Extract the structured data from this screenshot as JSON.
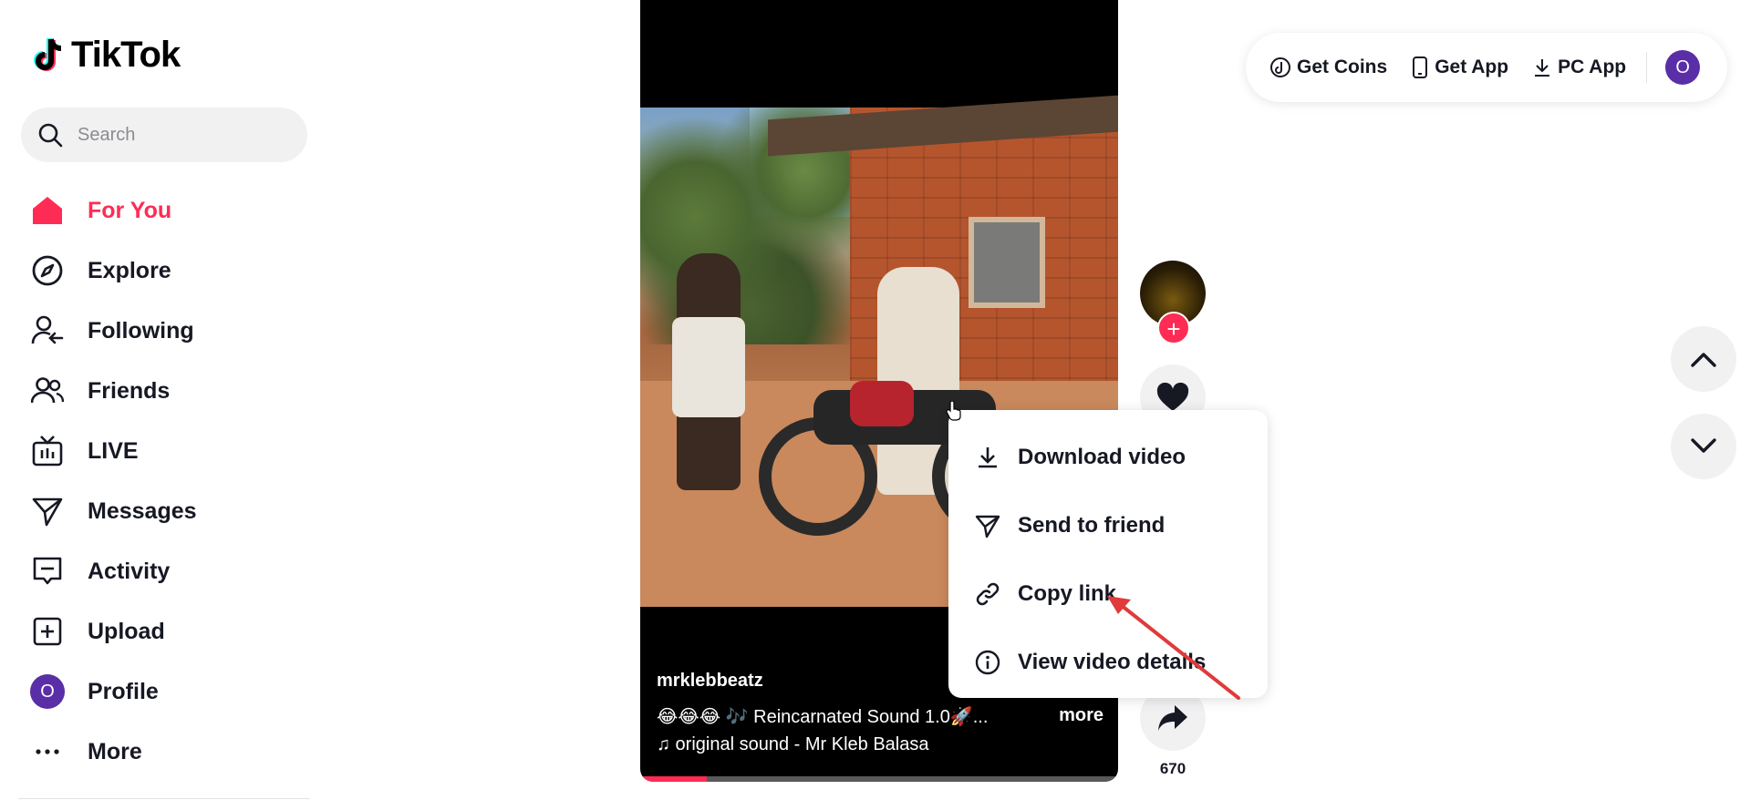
{
  "brand": {
    "name": "TikTok"
  },
  "search": {
    "placeholder": "Search"
  },
  "nav": {
    "items": [
      {
        "label": "For You",
        "icon": "home-icon",
        "active": true
      },
      {
        "label": "Explore",
        "icon": "compass-icon"
      },
      {
        "label": "Following",
        "icon": "following-icon"
      },
      {
        "label": "Friends",
        "icon": "friends-icon"
      },
      {
        "label": "LIVE",
        "icon": "live-icon"
      },
      {
        "label": "Messages",
        "icon": "messages-icon"
      },
      {
        "label": "Activity",
        "icon": "activity-icon"
      },
      {
        "label": "Upload",
        "icon": "upload-icon"
      },
      {
        "label": "Profile",
        "icon": "avatar",
        "avatar_letter": "O"
      },
      {
        "label": "More",
        "icon": "more-icon"
      }
    ]
  },
  "header": {
    "get_coins": "Get Coins",
    "get_app": "Get App",
    "pc_app": "PC App",
    "avatar_letter": "O"
  },
  "video": {
    "username": "mrklebbeatz",
    "description": "😂😂😂 🎶 Reincarnated Sound 1.0🚀...",
    "more": "more",
    "sound": "♫ original sound - Mr Kleb Balasa",
    "progress": 0.14
  },
  "actions": {
    "share_count": "670",
    "follow_symbol": "+"
  },
  "context_menu": {
    "items": [
      {
        "label": "Download video",
        "icon": "download-icon"
      },
      {
        "label": "Send to friend",
        "icon": "send-icon"
      },
      {
        "label": "Copy link",
        "icon": "link-icon"
      },
      {
        "label": "View video details",
        "icon": "info-icon"
      }
    ]
  },
  "colors": {
    "accent": "#fe2c55",
    "text": "#161823",
    "avatar": "#5a2ea6",
    "annotation_arrow": "#e03a3a"
  }
}
